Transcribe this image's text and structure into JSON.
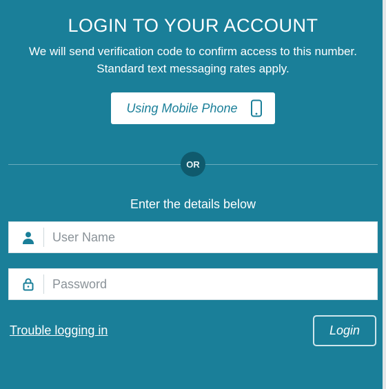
{
  "title": "LOGIN TO YOUR ACCOUNT",
  "subtitle": "We will send verification code to confirm access to this number. Standard text messaging rates apply.",
  "mobile_button_label": "Using Mobile Phone",
  "divider_label": "OR",
  "details_label": "Enter the details below",
  "username": {
    "placeholder": "User Name",
    "value": ""
  },
  "password": {
    "placeholder": "Password",
    "value": ""
  },
  "trouble_label": "Trouble logging in",
  "login_button_label": "Login",
  "icons": {
    "phone": "phone-icon",
    "user": "user-icon",
    "lock": "lock-icon"
  },
  "colors": {
    "background": "#1a7f99",
    "accent_dark": "#0f5a6d",
    "text": "#ffffff",
    "input_bg": "#ffffff",
    "placeholder": "#8a9298"
  }
}
